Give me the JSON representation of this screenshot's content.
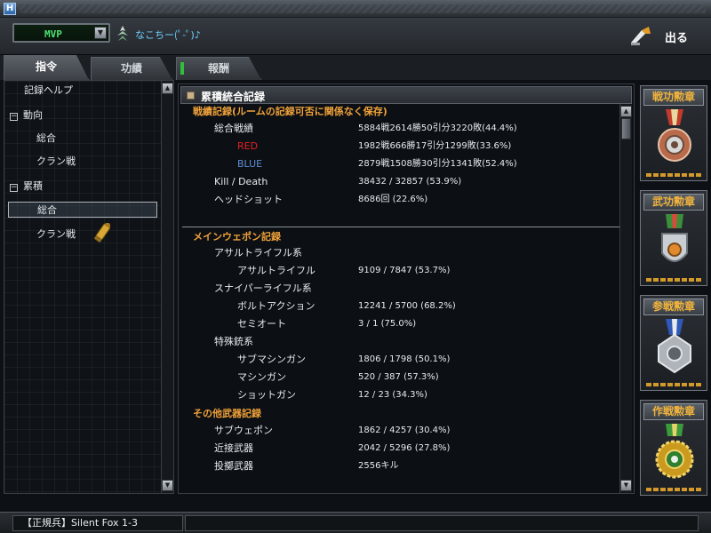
{
  "window": {
    "icon_letter": "H"
  },
  "topbar": {
    "mvp_value": "MVP",
    "nickname": "なこちー(ﾟ-ﾟ)♪",
    "exit_label": "出る"
  },
  "tabs": [
    {
      "label": "指令"
    },
    {
      "label": "功績"
    },
    {
      "label": "報酬"
    }
  ],
  "sidebar": {
    "items": [
      {
        "label": "記録ヘルプ"
      },
      {
        "label": "動向",
        "toggle": "−"
      },
      {
        "label": "総合"
      },
      {
        "label": "クラン戦"
      },
      {
        "label": "累積",
        "toggle": "−"
      },
      {
        "label": "総合"
      },
      {
        "label": "クラン戦"
      }
    ]
  },
  "main": {
    "title": "累積統合記録",
    "groups": [
      {
        "head": "戦績記録(ルームの記録可否に関係なく保存)"
      },
      {
        "head": "メインウェポン記録"
      },
      {
        "head": "その他武器記録"
      }
    ],
    "rows": [
      {
        "label": "総合戦績",
        "value": "5884戦2614勝50引分3220敗(44.4%)"
      },
      {
        "label": "RED",
        "value": "1982戦666勝17引分1299敗(33.6%)",
        "color": "#e02424"
      },
      {
        "label": "BLUE",
        "value": "2879戦1508勝30引分1341敗(52.4%)",
        "color": "#5b8fd6"
      },
      {
        "label": "Kill / Death",
        "value": "38432 / 32857 (53.9%)"
      },
      {
        "label": "ヘッドショット",
        "value": "8686回 (22.6%)"
      },
      {
        "label": "アサルトライフル系",
        "value": ""
      },
      {
        "label": "アサルトライフル",
        "value": "9109 / 7847 (53.7%)"
      },
      {
        "label": "スナイパーライフル系",
        "value": ""
      },
      {
        "label": "ボルトアクション",
        "value": "12241 / 5700 (68.2%)"
      },
      {
        "label": "セミオート",
        "value": "3 / 1 (75.0%)"
      },
      {
        "label": "特殊銃系",
        "value": ""
      },
      {
        "label": "サブマシンガン",
        "value": "1806 / 1798 (50.1%)"
      },
      {
        "label": "マシンガン",
        "value": "520 / 387 (57.3%)"
      },
      {
        "label": "ショットガン",
        "value": "12 / 23 (34.3%)"
      },
      {
        "label": "サブウェポン",
        "value": "1862 / 4257 (30.4%)"
      },
      {
        "label": "近接武器",
        "value": "2042 / 5296 (27.8%)"
      },
      {
        "label": "投擲武器",
        "value": "2556キル"
      }
    ]
  },
  "medals": [
    {
      "title": "戦功勲章",
      "ribbon": "#c23a2a",
      "icon": "bronze-medal-icon"
    },
    {
      "title": "武功勲章",
      "ribbon": "#3b8f3b",
      "icon": "shield-medal-icon"
    },
    {
      "title": "参戦勲章",
      "ribbon": "#2f58b8",
      "icon": "silver-medal-icon"
    },
    {
      "title": "作戦勲章",
      "ribbon": "#3c9a3c",
      "icon": "gold-medal-icon"
    }
  ],
  "status": {
    "rank_name": "【正規兵】Silent Fox 1-3"
  }
}
